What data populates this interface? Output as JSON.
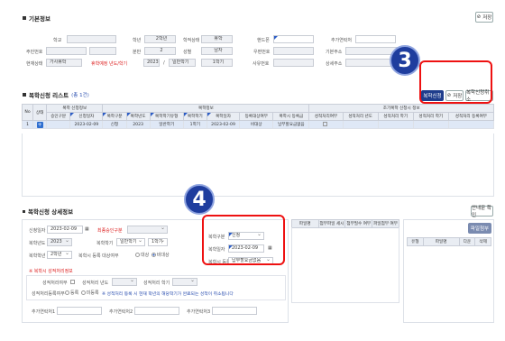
{
  "basic": {
    "title": "기본정보",
    "save": "저장",
    "fields": {
      "school": "학교",
      "grade_lbl": "학년",
      "grade_val": "2학년",
      "status_lbl": "학적상태",
      "status_val": "휴학",
      "phone_lbl": "핸드폰",
      "addrnum_lbl": "추가연락처",
      "resident_lbl": "주민번호",
      "class_lbl": "분반",
      "class_val": "2",
      "gender_lbl": "성별",
      "gender_val": "남자",
      "zip_lbl": "우편번호",
      "addr_lbl": "기본주소",
      "cur_status_lbl": "현재상태",
      "cur_status_val": "가사휴학",
      "return_lbl": "휴학예정 년도/학기",
      "return_year": "2023",
      "return_sem": "일반학기",
      "return_term": "1학기",
      "detail_addr_lbl": "상세주소",
      "foreign_lbl": "사유번호"
    }
  },
  "list": {
    "title": "복학신청 리스트",
    "count": "(총 1건)",
    "buttons": {
      "apply": "복학신청",
      "save": "저장",
      "cancel": "복학신청취소"
    },
    "group_headers": {
      "apply_info": "복학 신청정보",
      "return_info": "복학정보",
      "early": "조기복학 신청시 정보"
    },
    "headers": [
      "No",
      "상태",
      "승인구분",
      "신청일자",
      "복학구분",
      "복학년도",
      "복학학기유형",
      "복학학기",
      "복학일자",
      "등록대상여부",
      "복학시 등록금",
      "성적처리여부",
      "성적처리 년도",
      "성적처리 학기",
      "성적처리 학기",
      "성적처리 등록여부"
    ],
    "row": {
      "no": "1",
      "date": "2023-02-09",
      "type": "신청",
      "year": "2023",
      "sem_type": "일반학기",
      "term": "1학기",
      "ret_date": "2023-02-09",
      "target": "비대상",
      "fee": "납부할요금없음"
    }
  },
  "detail": {
    "title": "복학신청 상세정보",
    "info_btn": "안내문 확인",
    "apply_date_lbl": "신청일자",
    "apply_date": "2023-02-09",
    "approve_lbl": "최종승인구분",
    "year_lbl": "복학년도",
    "year": "2023",
    "sem_type_lbl": "복학학기",
    "sem_type": "일반학기",
    "term": "1학기",
    "grade_lbl": "복학학년",
    "grade": "2학년",
    "target_lbl": "복학시 등록 대상여부",
    "target_opt1": "대상",
    "target_opt2": "비대상",
    "type_lbl": "복학구분",
    "type": "신청",
    "ret_date_lbl": "복학일자",
    "ret_date": "2023-02-09",
    "fee_lbl": "복학시 등록금",
    "fee": "납부할요금없음",
    "file_col1": "파일명",
    "file_col2": "첨부파일 세시",
    "file_col3": "첨부필수 여부",
    "file_col4": "파일첨부 여부",
    "file_btn": "파일첨부",
    "file_h1": "유형",
    "file_h2": "파일명",
    "file_h3": "다운",
    "file_h4": "삭제",
    "early_title": "※ 복학시 성적처리정보",
    "early_yn_lbl": "성적처리여부",
    "early_year_lbl": "성적처리 년도",
    "early_term_lbl": "성적처리 학기",
    "early_reg_lbl": "성적처리등록여부",
    "early_reg_opt1": "등록",
    "early_reg_opt2": "미등록",
    "note": "※ 성적처리 등록 시 현재 학년의 해당학기가 완료되는 성적이 취소됩니다",
    "extra1": "추가연락처1",
    "extra2": "추가연락처2",
    "extra3": "추가연락처3"
  },
  "callouts": {
    "a": "3",
    "b": "4"
  }
}
